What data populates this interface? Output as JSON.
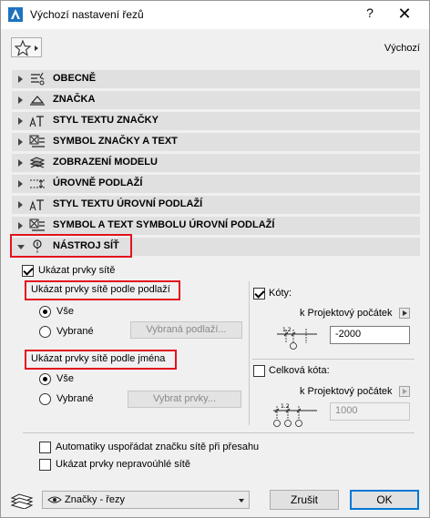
{
  "window": {
    "title": "Výchozí nastavení řezů",
    "help": "?",
    "close": "✕"
  },
  "header": {
    "favorites_icon": "star-icon",
    "preset": "Výchozí"
  },
  "panels": [
    {
      "label": "OBECNĚ",
      "icon": "general-settings-icon",
      "expanded": false
    },
    {
      "label": "ZNAČKA",
      "icon": "marker-icon",
      "expanded": false
    },
    {
      "label": "STYL TEXTU ZNAČKY",
      "icon": "text-style-icon",
      "expanded": false
    },
    {
      "label": "SYMBOL ZNAČKY A TEXT",
      "icon": "symbol-text-icon",
      "expanded": false
    },
    {
      "label": "ZOBRAZENÍ MODELU",
      "icon": "model-display-icon",
      "expanded": false
    },
    {
      "label": "ÚROVNĚ PODLAŽÍ",
      "icon": "story-levels-icon",
      "expanded": false
    },
    {
      "label": "STYL TEXTU ÚROVNÍ PODLAŽÍ",
      "icon": "text-style-icon",
      "expanded": false
    },
    {
      "label": "SYMBOL A TEXT SYMBOLU ÚROVNÍ PODLAŽÍ",
      "icon": "symbol-text-icon",
      "expanded": false
    },
    {
      "label": "NÁSTROJ SÍŤ",
      "icon": "grid-tool-icon",
      "expanded": true
    }
  ],
  "grid_tool": {
    "show_grid": {
      "label": "Ukázat prvky sítě",
      "checked": true
    },
    "by_story": {
      "heading": "Ukázat prvky sítě podle podlaží",
      "all": "Vše",
      "selected": "Vybrané",
      "selected_button": "Vybraná podlaží...",
      "value": "all"
    },
    "by_name": {
      "heading": "Ukázat prvky sítě podle jména",
      "all": "Vše",
      "selected": "Vybrané",
      "selected_button": "Vybrat prvky...",
      "value": "all"
    },
    "dimensions": {
      "label": "Kóty:",
      "checked": true,
      "reference": "k Projektový počátek",
      "value": "-2000"
    },
    "overall": {
      "label": "Celková kóta:",
      "checked": false,
      "reference": "k Projektový počátek",
      "value": "1000"
    },
    "auto_arrange": {
      "label": "Automatiky uspořádat značku sítě při přesahu",
      "checked": false
    },
    "show_nonortho": {
      "label": "Ukázat prvky nepravoúhlé sítě",
      "checked": false
    }
  },
  "footer": {
    "layer_icon": "layer-icon",
    "layer": "Značky - řezy",
    "cancel": "Zrušit",
    "ok": "OK"
  },
  "colors": {
    "highlight": "#e3121e",
    "accent": "#0078d7"
  }
}
